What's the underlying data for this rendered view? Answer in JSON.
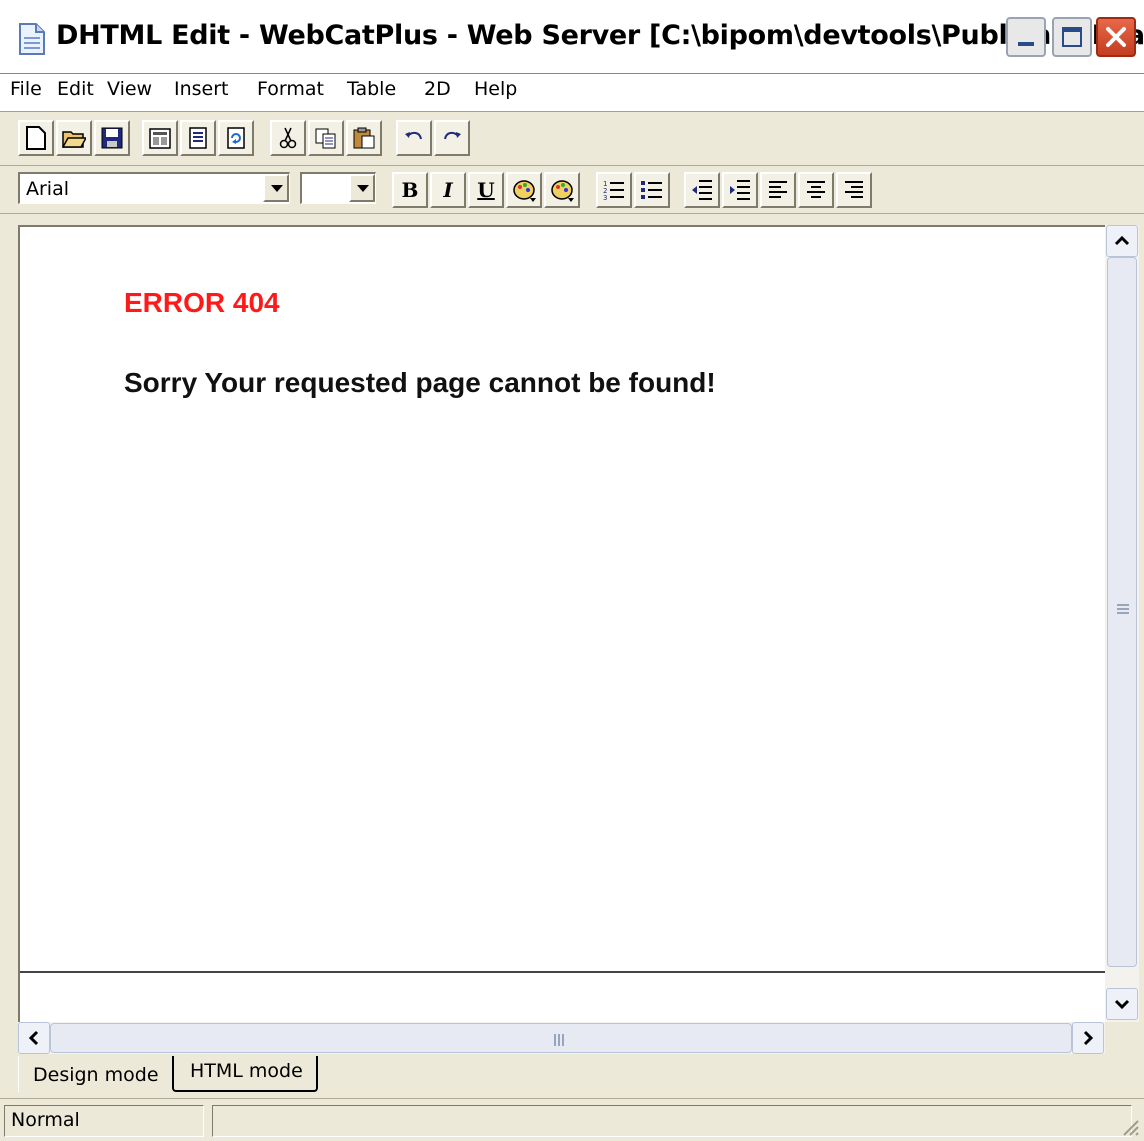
{
  "window": {
    "title": "DHTML Edit - WebCatPlus - Web Server [C:\\bipom\\devtools\\Publisher\\Exa...",
    "controls": [
      "minimize-icon",
      "maximize-icon",
      "close-icon"
    ]
  },
  "menu": [
    "File",
    "Edit",
    "View",
    "Insert",
    "Format",
    "Table",
    "2D",
    "Help"
  ],
  "toolbar1": [
    "new-document-icon",
    "open-folder-icon",
    "save-icon",
    "properties-icon",
    "document-icon",
    "refresh-icon",
    "cut-icon",
    "copy-icon",
    "paste-icon",
    "undo-icon",
    "redo-icon"
  ],
  "toolbar2": {
    "font": "Arial",
    "size": "",
    "bold": "B",
    "italic": "I",
    "underline": "U",
    "icons": [
      "foreground-color-icon",
      "background-color-icon",
      "numbered-list-icon",
      "bulleted-list-icon",
      "outdent-icon",
      "indent-icon",
      "align-left-icon",
      "align-center-icon",
      "align-right-icon"
    ]
  },
  "document": {
    "heading": "ERROR 404",
    "message": "Sorry Your requested page cannot be found!",
    "colors": {
      "heading": "#ff1a1a",
      "message": "#111111"
    }
  },
  "tabs": {
    "design": "Design mode",
    "html": "HTML mode"
  },
  "status": {
    "style": "Normal",
    "info": ""
  }
}
